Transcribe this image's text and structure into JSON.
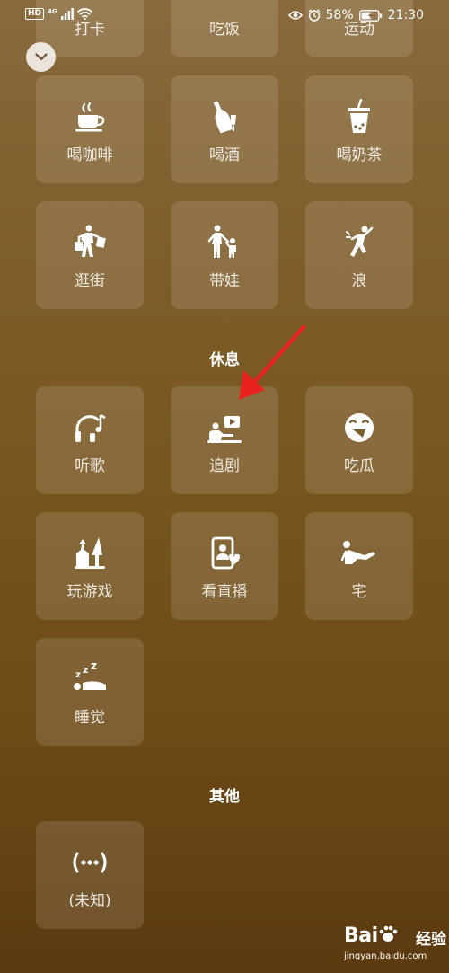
{
  "status_bar": {
    "network": "HD",
    "signal_type": "4G",
    "battery": "58%",
    "time": "21:30"
  },
  "tiles": {
    "daka": "打卡",
    "chifan": "吃饭",
    "yundong": "运动",
    "he_kafei": "喝咖啡",
    "hejiu": "喝酒",
    "he_naicha": "喝奶茶",
    "guangjie": "逛街",
    "daiwa": "带娃",
    "lang": "浪",
    "tingge": "听歌",
    "zhuiju": "追剧",
    "chigua": "吃瓜",
    "wan_youxi": "玩游戏",
    "kan_zhibo": "看直播",
    "zhai": "宅",
    "shuijiao": "睡觉",
    "weizhi": "(未知)"
  },
  "sections": {
    "rest": "休息",
    "other": "其他"
  },
  "watermark": {
    "logo": "Bai",
    "text": "经验",
    "url": "jingyan.baidu.com"
  },
  "colors": {
    "background_top": "#8a6a3c",
    "background_bottom": "#5b3a10",
    "annotation_arrow": "#e8231e"
  }
}
